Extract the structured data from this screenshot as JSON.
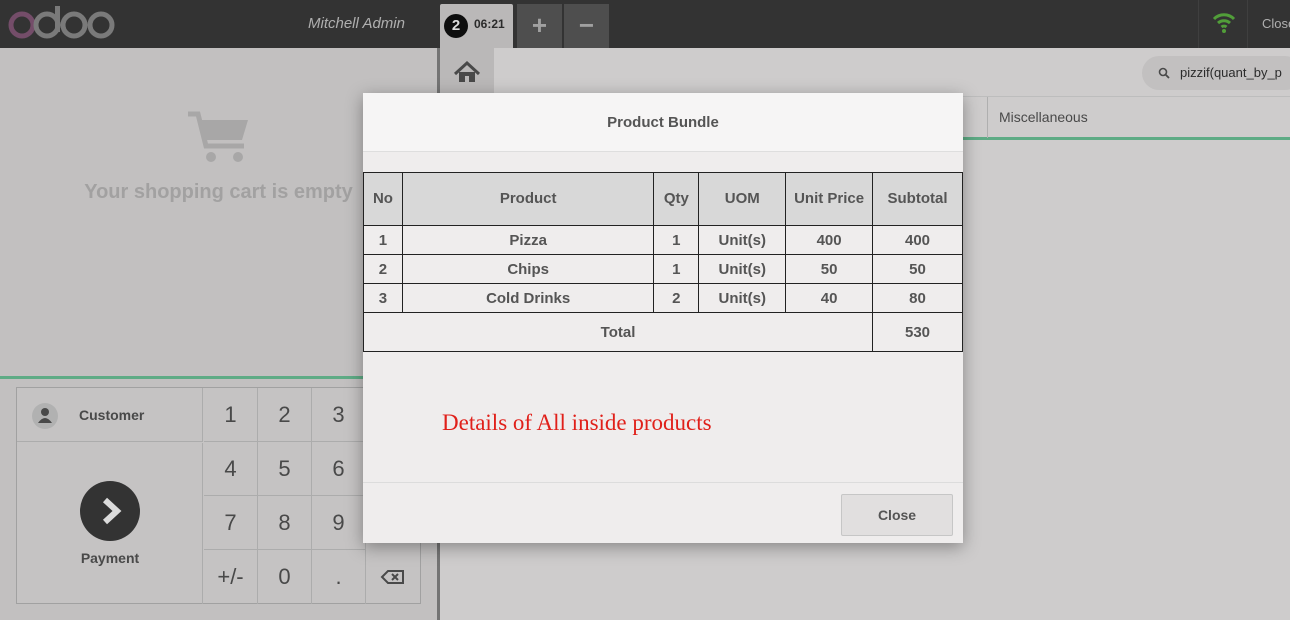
{
  "header": {
    "logo_text": "odoo",
    "cashier": "Mitchell Admin",
    "order": {
      "number": "2",
      "time": "06:21"
    },
    "add_label": "+",
    "remove_label": "−",
    "close_label": "Close"
  },
  "cart": {
    "empty_text": "Your shopping cart is empty"
  },
  "actionpad": {
    "customer_label": "Customer",
    "payment_label": "Payment",
    "keys": [
      "1",
      "2",
      "3",
      "4",
      "5",
      "6",
      "7",
      "8",
      "9",
      "+/-",
      "0",
      ".",
      "⌫"
    ]
  },
  "products_screen": {
    "search_value": "pizzif(quant_by_pr",
    "category": "Miscellaneous"
  },
  "modal": {
    "title": "Product Bundle",
    "columns": [
      "No",
      "Product",
      "Qty",
      "UOM",
      "Unit Price",
      "Subtotal"
    ],
    "rows": [
      [
        "1",
        "Pizza",
        "1",
        "Unit(s)",
        "400",
        "400"
      ],
      [
        "2",
        "Chips",
        "1",
        "Unit(s)",
        "50",
        "50"
      ],
      [
        "3",
        "Cold Drinks",
        "2",
        "Unit(s)",
        "40",
        "80"
      ]
    ],
    "total_label": "Total",
    "total_value": "530",
    "note": "Details of All inside products",
    "close_label": "Close"
  },
  "colors": {
    "topbar": "#3c3c3c",
    "accent_green": "#6ec89b",
    "logo_purple": "#875a7b",
    "logo_grey": "#8f8f8f",
    "wifi_green": "#5fb843",
    "note_red": "#e0201a"
  }
}
